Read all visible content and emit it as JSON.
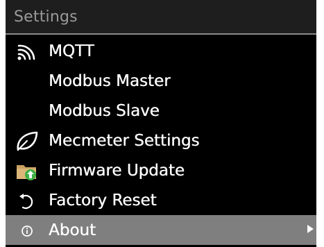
{
  "header": {
    "title": "Settings"
  },
  "menu": {
    "items": [
      {
        "label": "MQTT",
        "icon": "wifi-signal-icon"
      },
      {
        "label": "Modbus Master",
        "icon": ""
      },
      {
        "label": "Modbus Slave",
        "icon": ""
      },
      {
        "label": "Mecmeter Settings",
        "icon": "leaf-icon"
      },
      {
        "label": "Firmware Update",
        "icon": "folder-upload-icon"
      },
      {
        "label": "Factory Reset",
        "icon": "reset-arrow-icon"
      },
      {
        "label": "About",
        "icon": "info-icon"
      }
    ],
    "selected_index": 6
  },
  "colors": {
    "background": "#000000",
    "title_bar": "#1e1e1e",
    "title_text": "#9a9a9a",
    "selected_row": "#7f7f7f",
    "folder": "#c8a060",
    "upload_arrow": "#3cb043"
  }
}
